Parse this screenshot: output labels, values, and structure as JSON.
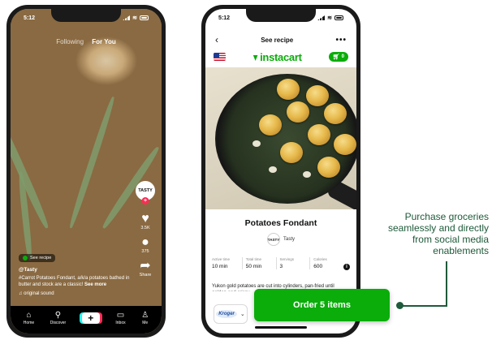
{
  "left_phone": {
    "status_time": "5:12",
    "tabs": {
      "following": "Following",
      "for_you": "For You"
    },
    "creator_badge": "TASTY",
    "like_count": "3.5K",
    "comment_count": "375",
    "share_label": "Share",
    "recipe_pill": "See recipe",
    "handle": "@Tasty",
    "caption": "#Carrot Potatoes Fondant, a/k/a potatoes bathed in butter and stock are a classic!",
    "see_more": "See more",
    "sound": "♫ original sound",
    "nav": [
      {
        "label": "Home",
        "icon": "home-icon"
      },
      {
        "label": "Discover",
        "icon": "search-icon"
      },
      {
        "label": "",
        "icon": "create-plus-icon"
      },
      {
        "label": "Inbox",
        "icon": "inbox-icon"
      },
      {
        "label": "Me",
        "icon": "profile-icon"
      }
    ]
  },
  "right_phone": {
    "status_time": "5:12",
    "header_title": "See recipe",
    "brand": "instacart",
    "cart_count": "0",
    "recipe_title": "Potatoes Fondant",
    "author": "Tasty",
    "stats": [
      {
        "label": "Active time",
        "value": "10 min"
      },
      {
        "label": "Total time",
        "value": "50 min"
      },
      {
        "label": "Servings",
        "value": "3"
      },
      {
        "label": "Calories",
        "value": "600"
      }
    ],
    "description": "Yukon gold potatoes are cut into cylinders, pan-fried until golden and crispy.",
    "store": "Kroger"
  },
  "order_button": "Order 5 items",
  "callout": "Purchase groceries seamlessly and directly from social media enablements",
  "colors": {
    "instacart_green": "#0aad0a",
    "callout_green": "#1f5a3a"
  }
}
